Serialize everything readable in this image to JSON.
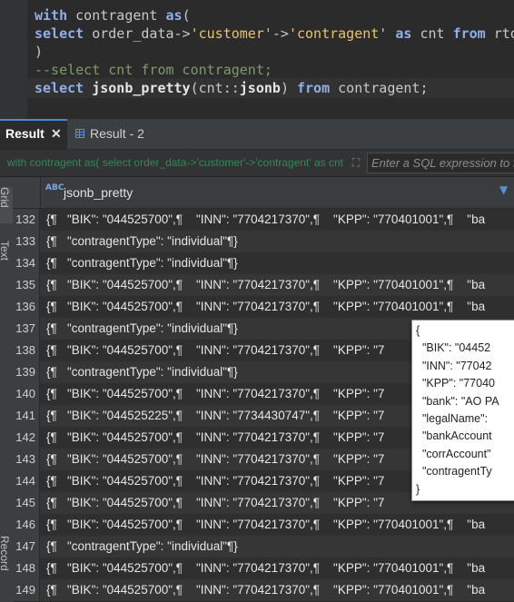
{
  "editor": {
    "line1": {
      "kw1": "with",
      "rest": " contragent ",
      "kw2": "as",
      "paren": "("
    },
    "line2": {
      "kw1": "select",
      "p1": " order_data->",
      "s1": "'customer'",
      "arrow": "->",
      "s2": "'contragent'",
      "sp": " ",
      "kw2": "as",
      "p2": " cnt ",
      "kw3": "from",
      "p3": " rto"
    },
    "line3": ")",
    "line4": "--select cnt from contragent;",
    "line5": {
      "kw1": "select",
      "sp": " ",
      "fn": "jsonb_pretty",
      "p1": "(cnt::",
      "kw2": "jsonb",
      "p2": ") ",
      "kw3": "from",
      "p3": " contragent;"
    }
  },
  "tabs": {
    "result_label": "Result",
    "close_glyph": "✕",
    "result2_label": "Result - 2"
  },
  "filter": {
    "query_text": "with contragent as( select order_data->'customer'->'contragent' as cnt from rto",
    "expand_glyph": "⛶",
    "placeholder": "Enter a SQL expression to filter results"
  },
  "side_tabs": {
    "grid": "Grid",
    "text": "Text",
    "record": "Record"
  },
  "grid": {
    "abc_icon": "ABC",
    "column": "jsonb_pretty",
    "filter_glyph": "▼",
    "rows": [
      {
        "num": "132",
        "value": "{¶   \"BIK\": \"044525700\",¶    \"INN\": \"7704217370\",¶    \"KPP\": \"770401001\",¶    \"ba"
      },
      {
        "num": "133",
        "value": "{¶   \"contragentType\": \"individual\"¶}"
      },
      {
        "num": "134",
        "value": "{¶   \"contragentType\": \"individual\"¶}"
      },
      {
        "num": "135",
        "value": "{¶   \"BIK\": \"044525700\",¶    \"INN\": \"7704217370\",¶    \"KPP\": \"770401001\",¶    \"ba"
      },
      {
        "num": "136",
        "value": "{¶   \"BIK\": \"044525700\",¶    \"INN\": \"7704217370\",¶    \"KPP\": \"770401001\",¶    \"ba"
      },
      {
        "num": "137",
        "value": "{¶   \"contragentType\": \"individual\"¶}"
      },
      {
        "num": "138",
        "value": "{¶   \"BIK\": \"044525700\",¶    \"INN\": \"7704217370\",¶    \"KPP\": \"7"
      },
      {
        "num": "139",
        "value": "{¶   \"contragentType\": \"individual\"¶}"
      },
      {
        "num": "140",
        "value": "{¶   \"BIK\": \"044525700\",¶    \"INN\": \"7704217370\",¶    \"KPP\": \"7"
      },
      {
        "num": "141",
        "value": "{¶   \"BIK\": \"044525225\",¶    \"INN\": \"7734430747\",¶    \"KPP\": \"7"
      },
      {
        "num": "142",
        "value": "{¶   \"BIK\": \"044525700\",¶    \"INN\": \"7704217370\",¶    \"KPP\": \"7"
      },
      {
        "num": "143",
        "value": "{¶   \"BIK\": \"044525700\",¶    \"INN\": \"7704217370\",¶    \"KPP\": \"7"
      },
      {
        "num": "144",
        "value": "{¶   \"BIK\": \"044525700\",¶    \"INN\": \"7704217370\",¶    \"KPP\": \"7"
      },
      {
        "num": "145",
        "value": "{¶   \"BIK\": \"044525700\",¶    \"INN\": \"7704217370\",¶    \"KPP\": \"7"
      },
      {
        "num": "146",
        "value": "{¶   \"BIK\": \"044525700\",¶    \"INN\": \"7704217370\",¶    \"KPP\": \"770401001\",¶    \"ba"
      },
      {
        "num": "147",
        "value": "{¶   \"contragentType\": \"individual\"¶}"
      },
      {
        "num": "148",
        "value": "{¶   \"BIK\": \"044525700\",¶    \"INN\": \"7704217370\",¶    \"KPP\": \"770401001\",¶    \"ba"
      },
      {
        "num": "149",
        "value": "{¶   \"BIK\": \"044525700\",¶    \"INN\": \"7704217370\",¶    \"KPP\": \"770401001\",¶    \"ba"
      }
    ]
  },
  "tooltip": {
    "lines": [
      "{",
      "  \"BIK\": \"04452",
      "  \"INN\": \"77042",
      "  \"KPP\": \"77040",
      "  \"bank\": \"AO PA",
      "  \"legalName\":",
      "  \"bankAccount",
      "  \"corrAccount\"",
      "  \"contragentTy",
      "}"
    ]
  }
}
